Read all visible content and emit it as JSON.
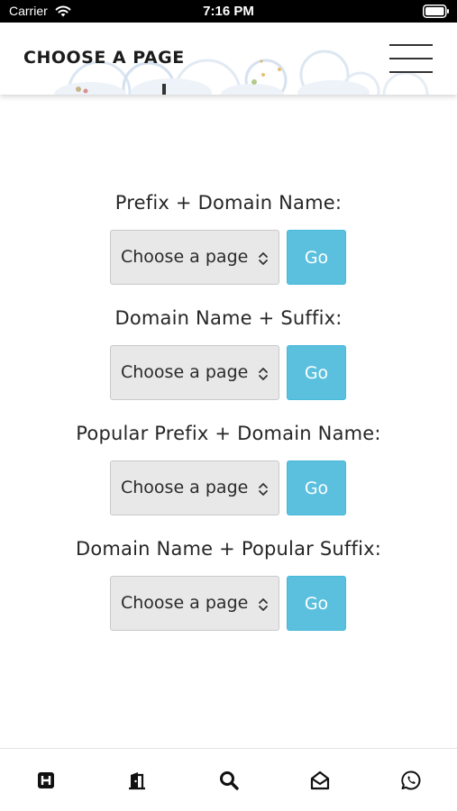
{
  "status_bar": {
    "carrier": "Carrier",
    "time": "7:16 PM"
  },
  "header": {
    "title": "CHOOSE A PAGE"
  },
  "form_groups": [
    {
      "label": "Prefix + Domain Name:",
      "select_value": "Choose a page",
      "button_label": "Go"
    },
    {
      "label": "Domain Name + Suffix:",
      "select_value": "Choose a page",
      "button_label": "Go"
    },
    {
      "label": "Popular Prefix + Domain Name:",
      "select_value": "Choose a page",
      "button_label": "Go"
    },
    {
      "label": "Domain Name + Popular Suffix:",
      "select_value": "Choose a page",
      "button_label": "Go"
    }
  ],
  "tab_bar": {
    "items": [
      {
        "icon": "hospital-h-icon"
      },
      {
        "icon": "door-open-icon"
      },
      {
        "icon": "search-icon"
      },
      {
        "icon": "envelope-open-icon"
      },
      {
        "icon": "whatsapp-icon"
      }
    ]
  },
  "colors": {
    "accent": "#5bc0de",
    "select_bg": "#e8e8e8",
    "status_bar": "#000000"
  }
}
